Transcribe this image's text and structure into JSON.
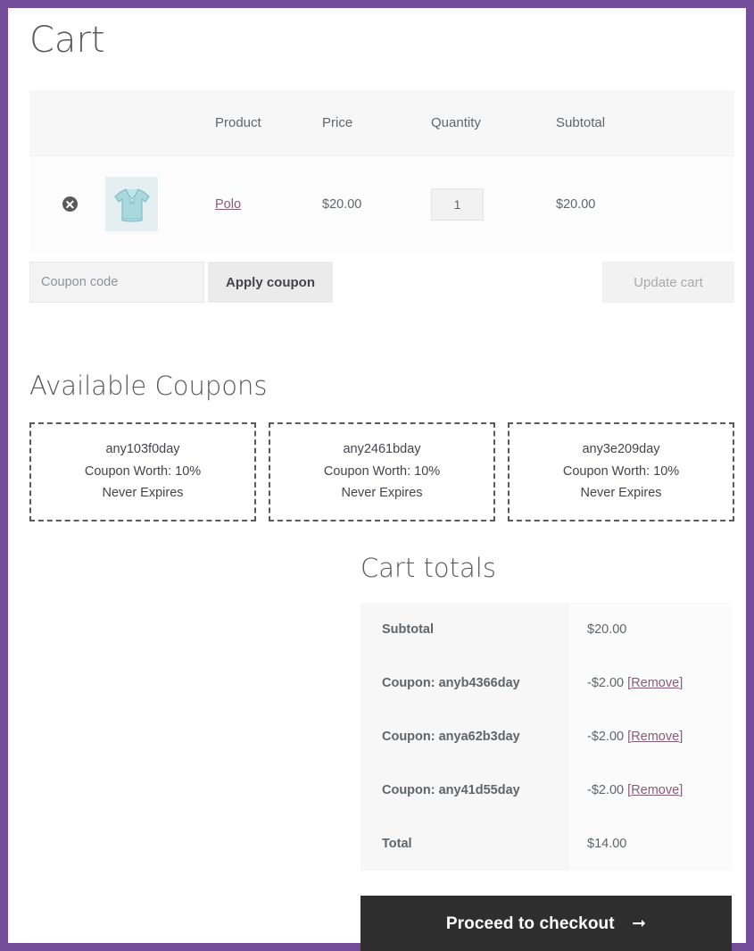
{
  "theme": {
    "frame_color": "#744e9a",
    "link_color": "#8a5a77",
    "checkout_button_bg": "#2e2e2e",
    "table_header_bg": "#f7f7f7"
  },
  "page": {
    "title": "Cart"
  },
  "cart_table": {
    "headers": {
      "remove": "",
      "thumbnail": "",
      "product": "Product",
      "price": "Price",
      "quantity": "Quantity",
      "subtotal": "Subtotal"
    },
    "rows": [
      {
        "remove_label": "×",
        "thumbnail_alt": "polo-shirt-thumbnail",
        "product": "Polo",
        "price": "$20.00",
        "quantity": "1",
        "subtotal": "$20.00"
      }
    ]
  },
  "cart_actions": {
    "coupon_placeholder": "Coupon code",
    "coupon_value": "",
    "apply_coupon_label": "Apply coupon",
    "update_cart_label": "Update cart"
  },
  "available_coupons": {
    "title": "Available Coupons",
    "cards": [
      {
        "code": "any103f0day",
        "worth": "Coupon Worth: 10%",
        "expiry": "Never Expires"
      },
      {
        "code": "any2461bday",
        "worth": "Coupon Worth: 10%",
        "expiry": "Never Expires"
      },
      {
        "code": "any3e209day",
        "worth": "Coupon Worth: 10%",
        "expiry": "Never Expires"
      }
    ]
  },
  "cart_totals": {
    "title": "Cart totals",
    "rows": [
      {
        "label": "Subtotal",
        "value": "$20.00",
        "remove": ""
      },
      {
        "label": "Coupon: anyb4366day",
        "value": "-$2.00",
        "remove": "[Remove]"
      },
      {
        "label": "Coupon: anya62b3day",
        "value": "-$2.00",
        "remove": "[Remove]"
      },
      {
        "label": "Coupon: any41d55day",
        "value": "-$2.00",
        "remove": "[Remove]"
      },
      {
        "label": "Total",
        "value": "$14.00",
        "remove": ""
      }
    ],
    "checkout_label": "Proceed to checkout",
    "checkout_arrow": "➞"
  }
}
